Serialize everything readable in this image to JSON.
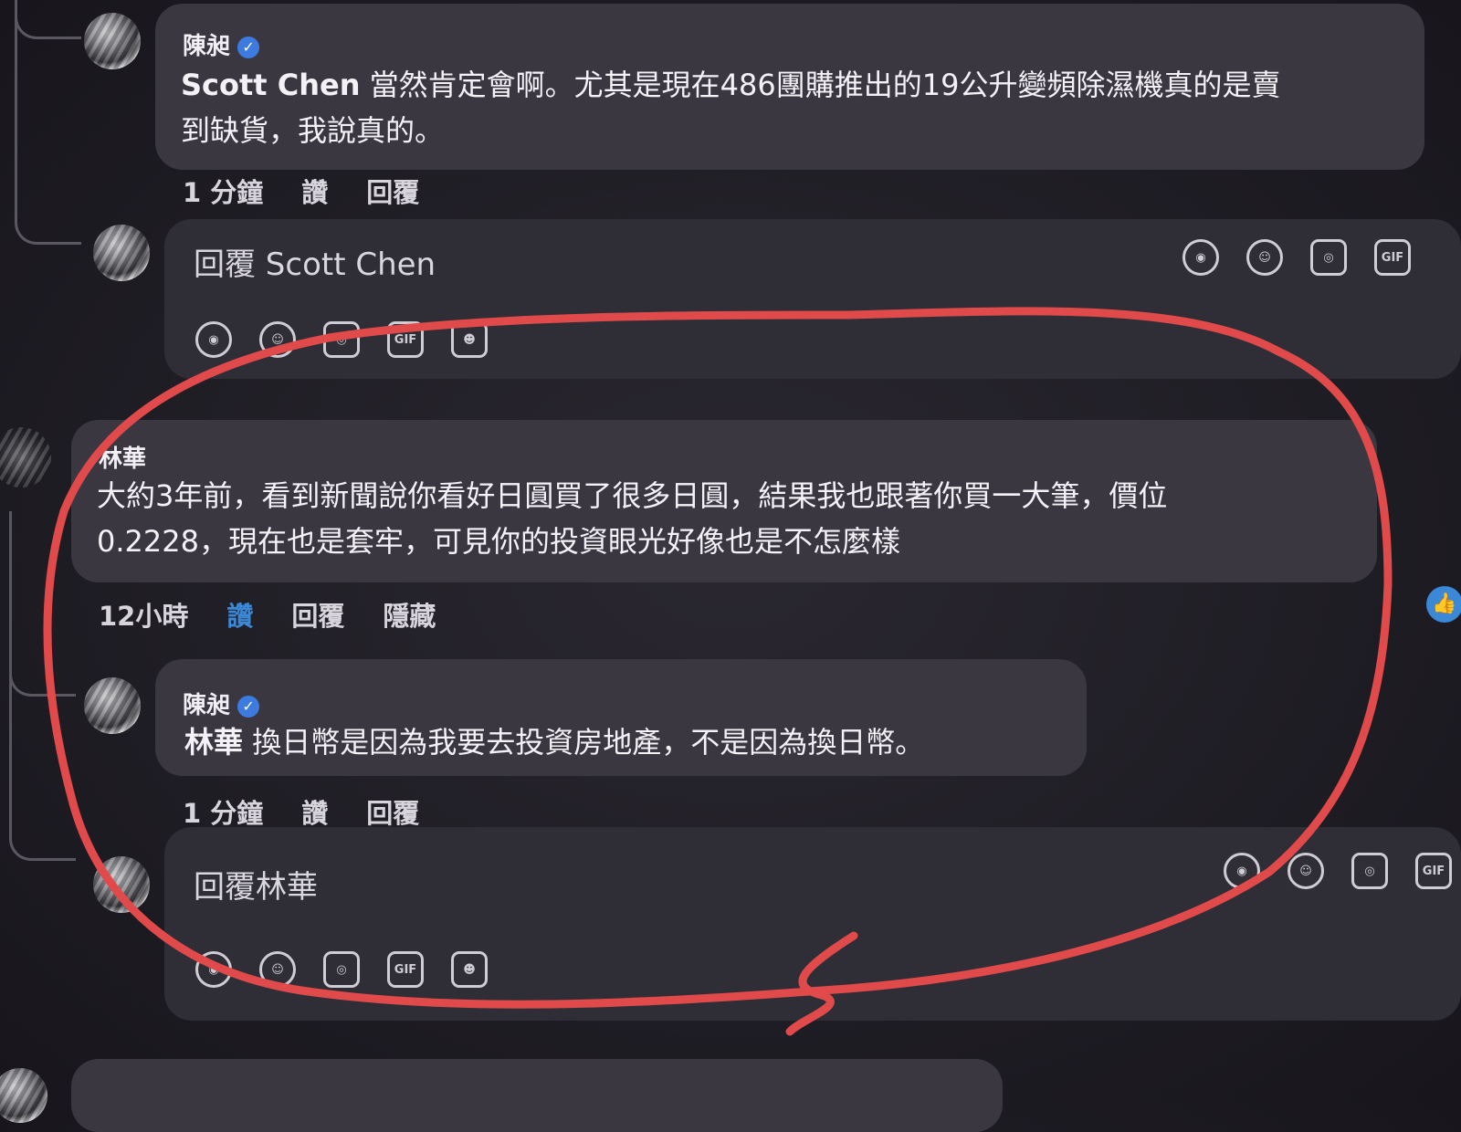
{
  "comments": [
    {
      "author": "陳昶",
      "mention": "Scott Chen",
      "text_line1": " 當然肯定會啊。尤其是現在486團購推出的19公升變頻除濕機真的是賣",
      "text_line2": "到缺貨，我說真的。",
      "time": "1 分鐘",
      "like": "讚",
      "reply": "回覆"
    },
    {
      "author": "林華",
      "text_line1": "大約3年前，看到新聞說你看好日圓買了很多日圓，結果我也跟著你買一大筆，價位",
      "text_line2": "0.2228，現在也是套牢，可見你的投資眼光好像也是不怎麼樣",
      "time": "12小時",
      "like": "讚",
      "reply": "回覆",
      "hide": "隱藏"
    },
    {
      "author": "陳昶",
      "mention": "林華",
      "text": " 換日幣是因為我要去投資房地產，不是因為換日幣。",
      "time": "1 分鐘",
      "like": "讚",
      "reply": "回覆"
    }
  ],
  "composers": [
    {
      "placeholder": "回覆 Scott Chen"
    },
    {
      "placeholder": "回覆林華"
    }
  ],
  "icons": [
    "avatar-sticker-icon",
    "emoji-icon",
    "camera-icon",
    "gif-icon",
    "sticker-icon"
  ],
  "gif_label": "GIF",
  "annotation_color": "#e04a4a",
  "like_active_color": "#3b88d6"
}
